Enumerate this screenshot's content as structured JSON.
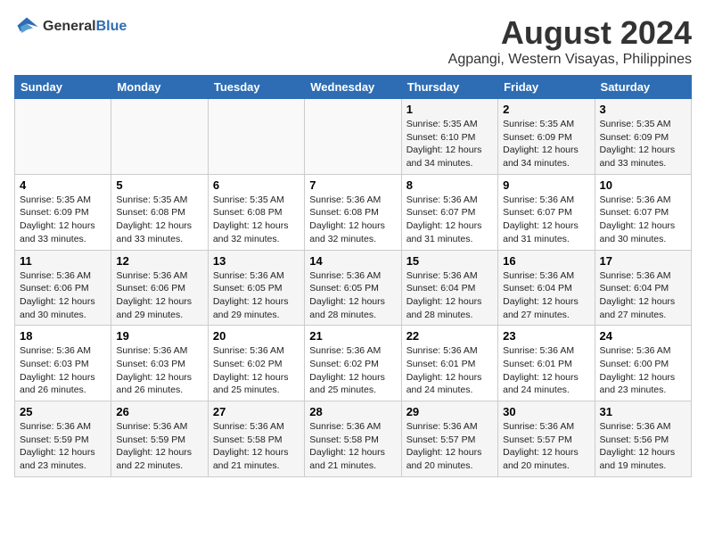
{
  "header": {
    "logo_general": "General",
    "logo_blue": "Blue",
    "title": "August 2024",
    "subtitle": "Agpangi, Western Visayas, Philippines"
  },
  "weekdays": [
    "Sunday",
    "Monday",
    "Tuesday",
    "Wednesday",
    "Thursday",
    "Friday",
    "Saturday"
  ],
  "weeks": [
    [
      {
        "day": "",
        "info": ""
      },
      {
        "day": "",
        "info": ""
      },
      {
        "day": "",
        "info": ""
      },
      {
        "day": "",
        "info": ""
      },
      {
        "day": "1",
        "info": "Sunrise: 5:35 AM\nSunset: 6:10 PM\nDaylight: 12 hours\nand 34 minutes."
      },
      {
        "day": "2",
        "info": "Sunrise: 5:35 AM\nSunset: 6:09 PM\nDaylight: 12 hours\nand 34 minutes."
      },
      {
        "day": "3",
        "info": "Sunrise: 5:35 AM\nSunset: 6:09 PM\nDaylight: 12 hours\nand 33 minutes."
      }
    ],
    [
      {
        "day": "4",
        "info": "Sunrise: 5:35 AM\nSunset: 6:09 PM\nDaylight: 12 hours\nand 33 minutes."
      },
      {
        "day": "5",
        "info": "Sunrise: 5:35 AM\nSunset: 6:08 PM\nDaylight: 12 hours\nand 33 minutes."
      },
      {
        "day": "6",
        "info": "Sunrise: 5:35 AM\nSunset: 6:08 PM\nDaylight: 12 hours\nand 32 minutes."
      },
      {
        "day": "7",
        "info": "Sunrise: 5:36 AM\nSunset: 6:08 PM\nDaylight: 12 hours\nand 32 minutes."
      },
      {
        "day": "8",
        "info": "Sunrise: 5:36 AM\nSunset: 6:07 PM\nDaylight: 12 hours\nand 31 minutes."
      },
      {
        "day": "9",
        "info": "Sunrise: 5:36 AM\nSunset: 6:07 PM\nDaylight: 12 hours\nand 31 minutes."
      },
      {
        "day": "10",
        "info": "Sunrise: 5:36 AM\nSunset: 6:07 PM\nDaylight: 12 hours\nand 30 minutes."
      }
    ],
    [
      {
        "day": "11",
        "info": "Sunrise: 5:36 AM\nSunset: 6:06 PM\nDaylight: 12 hours\nand 30 minutes."
      },
      {
        "day": "12",
        "info": "Sunrise: 5:36 AM\nSunset: 6:06 PM\nDaylight: 12 hours\nand 29 minutes."
      },
      {
        "day": "13",
        "info": "Sunrise: 5:36 AM\nSunset: 6:05 PM\nDaylight: 12 hours\nand 29 minutes."
      },
      {
        "day": "14",
        "info": "Sunrise: 5:36 AM\nSunset: 6:05 PM\nDaylight: 12 hours\nand 28 minutes."
      },
      {
        "day": "15",
        "info": "Sunrise: 5:36 AM\nSunset: 6:04 PM\nDaylight: 12 hours\nand 28 minutes."
      },
      {
        "day": "16",
        "info": "Sunrise: 5:36 AM\nSunset: 6:04 PM\nDaylight: 12 hours\nand 27 minutes."
      },
      {
        "day": "17",
        "info": "Sunrise: 5:36 AM\nSunset: 6:04 PM\nDaylight: 12 hours\nand 27 minutes."
      }
    ],
    [
      {
        "day": "18",
        "info": "Sunrise: 5:36 AM\nSunset: 6:03 PM\nDaylight: 12 hours\nand 26 minutes."
      },
      {
        "day": "19",
        "info": "Sunrise: 5:36 AM\nSunset: 6:03 PM\nDaylight: 12 hours\nand 26 minutes."
      },
      {
        "day": "20",
        "info": "Sunrise: 5:36 AM\nSunset: 6:02 PM\nDaylight: 12 hours\nand 25 minutes."
      },
      {
        "day": "21",
        "info": "Sunrise: 5:36 AM\nSunset: 6:02 PM\nDaylight: 12 hours\nand 25 minutes."
      },
      {
        "day": "22",
        "info": "Sunrise: 5:36 AM\nSunset: 6:01 PM\nDaylight: 12 hours\nand 24 minutes."
      },
      {
        "day": "23",
        "info": "Sunrise: 5:36 AM\nSunset: 6:01 PM\nDaylight: 12 hours\nand 24 minutes."
      },
      {
        "day": "24",
        "info": "Sunrise: 5:36 AM\nSunset: 6:00 PM\nDaylight: 12 hours\nand 23 minutes."
      }
    ],
    [
      {
        "day": "25",
        "info": "Sunrise: 5:36 AM\nSunset: 5:59 PM\nDaylight: 12 hours\nand 23 minutes."
      },
      {
        "day": "26",
        "info": "Sunrise: 5:36 AM\nSunset: 5:59 PM\nDaylight: 12 hours\nand 22 minutes."
      },
      {
        "day": "27",
        "info": "Sunrise: 5:36 AM\nSunset: 5:58 PM\nDaylight: 12 hours\nand 21 minutes."
      },
      {
        "day": "28",
        "info": "Sunrise: 5:36 AM\nSunset: 5:58 PM\nDaylight: 12 hours\nand 21 minutes."
      },
      {
        "day": "29",
        "info": "Sunrise: 5:36 AM\nSunset: 5:57 PM\nDaylight: 12 hours\nand 20 minutes."
      },
      {
        "day": "30",
        "info": "Sunrise: 5:36 AM\nSunset: 5:57 PM\nDaylight: 12 hours\nand 20 minutes."
      },
      {
        "day": "31",
        "info": "Sunrise: 5:36 AM\nSunset: 5:56 PM\nDaylight: 12 hours\nand 19 minutes."
      }
    ]
  ]
}
